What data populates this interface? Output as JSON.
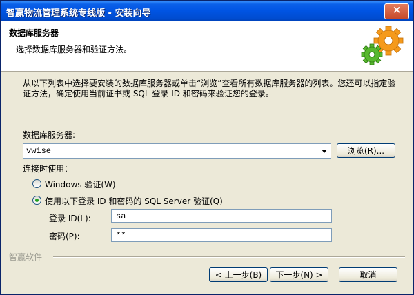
{
  "window": {
    "title": "智赢物流管理系统专线版 - 安装向导",
    "close_label": "×"
  },
  "header": {
    "title": "数据库服务器",
    "subtitle": "选择数据库服务器和验证方法。"
  },
  "body": {
    "description": "从以下列表中选择要安装的数据库服务器或单击“浏览”查看所有数据库服务器的列表。您还可以指定验证方法，确定使用当前证书或 SQL 登录 ID 和密码来验证您的登录。",
    "server_label": "数据库服务器:",
    "server_value": "vwise",
    "browse_label": "浏览(R)...",
    "connect_label": "连接时使用：",
    "auth_windows": "Windows 验证(W)",
    "auth_sql": "使用以下登录 ID 和密码的 SQL Server 验证(Q)",
    "login_label": "登录 ID(L):",
    "login_value": "sa",
    "password_label": "密码(P):",
    "password_value": "**",
    "selected_auth": "sql"
  },
  "footer": {
    "brand": "智赢软件",
    "back_label": "< 上一步(B)",
    "next_label": "下一步(N) >",
    "cancel_label": "取消"
  },
  "colors": {
    "titlebar": "#0054e3",
    "window_bg": "#ece9d8",
    "gear_orange": "#f59a1b",
    "gear_green": "#57b82e"
  }
}
